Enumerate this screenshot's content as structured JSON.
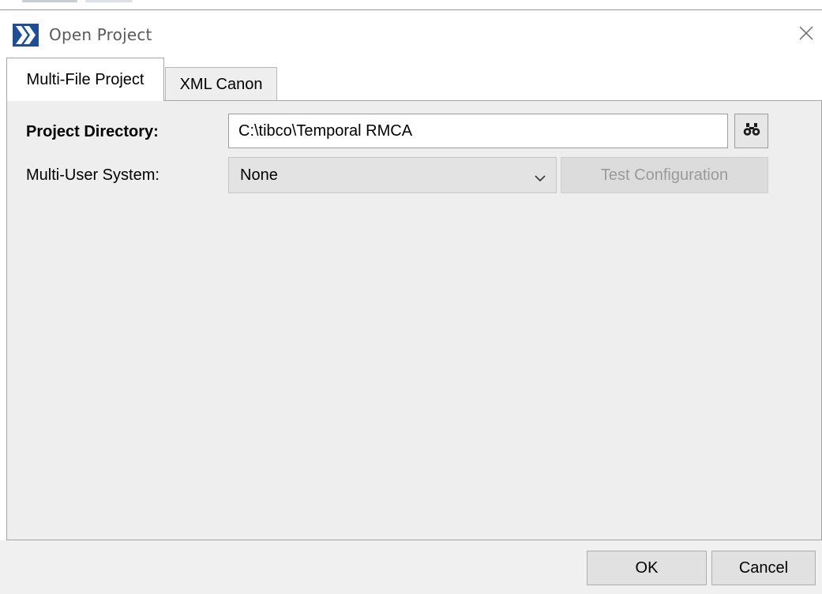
{
  "window": {
    "title": "Open Project",
    "app_icon": "tibco-logo-icon",
    "close_icon": "close-icon"
  },
  "tabs": [
    {
      "label": "Multi-File Project",
      "active": true
    },
    {
      "label": "XML Canon",
      "active": false
    }
  ],
  "form": {
    "project_directory_label": "Project Directory:",
    "project_directory_value": "C:\\tibco\\Temporal RMCA",
    "browse_icon": "binoculars-icon",
    "multi_user_label": "Multi-User System:",
    "multi_user_value": "None",
    "dropdown_icon": "chevron-down-icon",
    "test_button_label": "Test Configuration"
  },
  "footer": {
    "ok_label": "OK",
    "cancel_label": "Cancel"
  },
  "colors": {
    "logo_blue": "#1f4e96",
    "panel_bg": "#eeeeee",
    "disabled_text": "#9a9a9a"
  }
}
